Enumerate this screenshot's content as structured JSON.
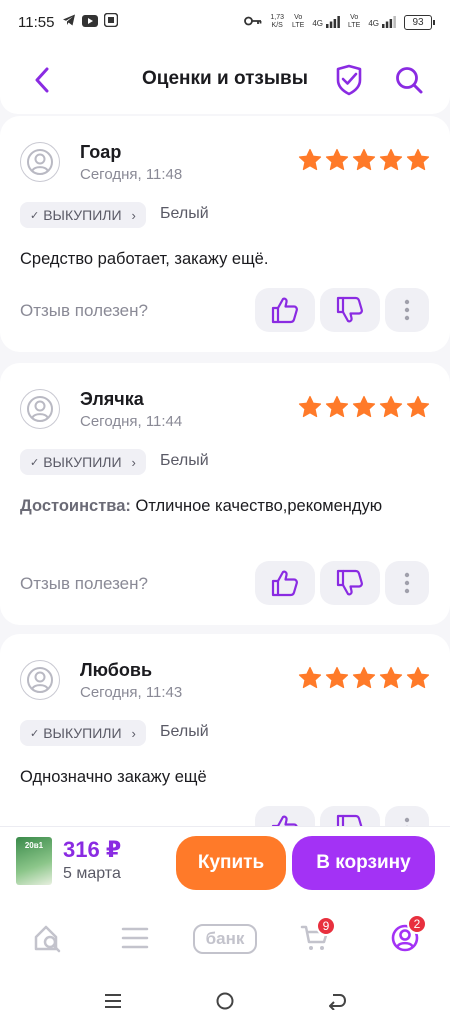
{
  "status_bar": {
    "time": "11:55",
    "net_speed_value": "1,73",
    "net_speed_unit": "K/S",
    "sim1_label": "Vo",
    "sim1_sub": "LTE",
    "sim1_gen": "4G",
    "sim2_label": "Vo",
    "sim2_sub": "LTE",
    "sim2_gen": "4G",
    "battery": "93"
  },
  "header": {
    "title": "Оценки и отзывы",
    "back_icon": "chevron-left-icon",
    "shield_icon": "shield-check-icon",
    "search_icon": "search-icon"
  },
  "colors": {
    "accent": "#8a2be2",
    "star": "#ff7a29",
    "buy": "#ff7a29",
    "cart": "#a332f5",
    "badge_red": "#e8303e"
  },
  "reviews": [
    {
      "author": "Гоар",
      "date": "Сегодня, 11:48",
      "rating": 5,
      "badge": "ВЫКУПИЛИ",
      "variant": "Белый",
      "pros_label": "",
      "text": "Средство работает, закажу ещё.",
      "helpful": "Отзыв полезен?"
    },
    {
      "author": "Элячка",
      "date": "Сегодня, 11:44",
      "rating": 5,
      "badge": "ВЫКУПИЛИ",
      "variant": "Белый",
      "pros_label": "Достоинства:",
      "text": "Отличное качество,рекомендую",
      "helpful": "Отзыв полезен?"
    },
    {
      "author": "Любовь",
      "date": "Сегодня, 11:43",
      "rating": 5,
      "badge": "ВЫКУПИЛИ",
      "variant": "Белый",
      "pros_label": "",
      "text": "Однозначно закажу ещё",
      "helpful": ""
    }
  ],
  "buybar": {
    "thumb_text": "20в1",
    "price": "316 ₽",
    "delivery": "5 марта",
    "buy_label": "Купить",
    "cart_label": "В корзину"
  },
  "bottom_nav": {
    "bank_label": "банк",
    "cart_count": "9",
    "profile_count": "2"
  }
}
